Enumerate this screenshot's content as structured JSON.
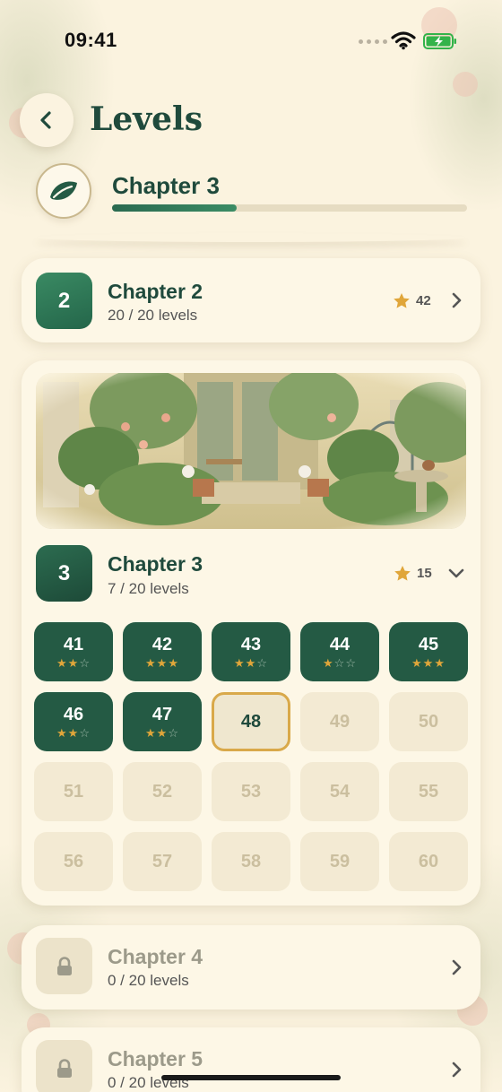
{
  "status_bar": {
    "time": "09:41"
  },
  "header": {
    "title": "Levels"
  },
  "current": {
    "chapter_label": "Chapter 3",
    "progress": 0.35
  },
  "chapters": [
    {
      "number": "2",
      "title": "Chapter 2",
      "subtitle": "20 / 20 levels",
      "stars": "42",
      "state": "completed"
    },
    {
      "number": "3",
      "title": "Chapter 3",
      "subtitle": "7 / 20 levels",
      "stars": "15",
      "state": "in-progress"
    },
    {
      "title": "Chapter 4",
      "subtitle": "0 / 20 levels",
      "state": "locked"
    },
    {
      "title": "Chapter 5",
      "subtitle": "0 / 20 levels",
      "state": "locked"
    }
  ],
  "levels": [
    {
      "n": "41",
      "stars": 2,
      "state": "done"
    },
    {
      "n": "42",
      "stars": 3,
      "state": "done"
    },
    {
      "n": "43",
      "stars": 2,
      "state": "done"
    },
    {
      "n": "44",
      "stars": 1,
      "state": "done"
    },
    {
      "n": "45",
      "stars": 3,
      "state": "done"
    },
    {
      "n": "46",
      "stars": 2,
      "state": "done"
    },
    {
      "n": "47",
      "stars": 2,
      "state": "done"
    },
    {
      "n": "48",
      "stars": 0,
      "state": "current"
    },
    {
      "n": "49",
      "stars": 0,
      "state": "locked"
    },
    {
      "n": "50",
      "stars": 0,
      "state": "locked"
    },
    {
      "n": "51",
      "stars": 0,
      "state": "locked"
    },
    {
      "n": "52",
      "stars": 0,
      "state": "locked"
    },
    {
      "n": "53",
      "stars": 0,
      "state": "locked"
    },
    {
      "n": "54",
      "stars": 0,
      "state": "locked"
    },
    {
      "n": "55",
      "stars": 0,
      "state": "locked"
    },
    {
      "n": "56",
      "stars": 0,
      "state": "locked"
    },
    {
      "n": "57",
      "stars": 0,
      "state": "locked"
    },
    {
      "n": "58",
      "stars": 0,
      "state": "locked"
    },
    {
      "n": "59",
      "stars": 0,
      "state": "locked"
    },
    {
      "n": "60",
      "stars": 0,
      "state": "locked"
    }
  ],
  "colors": {
    "accent": "#245a44",
    "gold": "#e0a63a",
    "background": "#fbf3df"
  },
  "icons": {
    "back": "chevron-left-icon",
    "leaf": "leaf-icon",
    "star": "star-icon",
    "lock": "lock-icon"
  }
}
